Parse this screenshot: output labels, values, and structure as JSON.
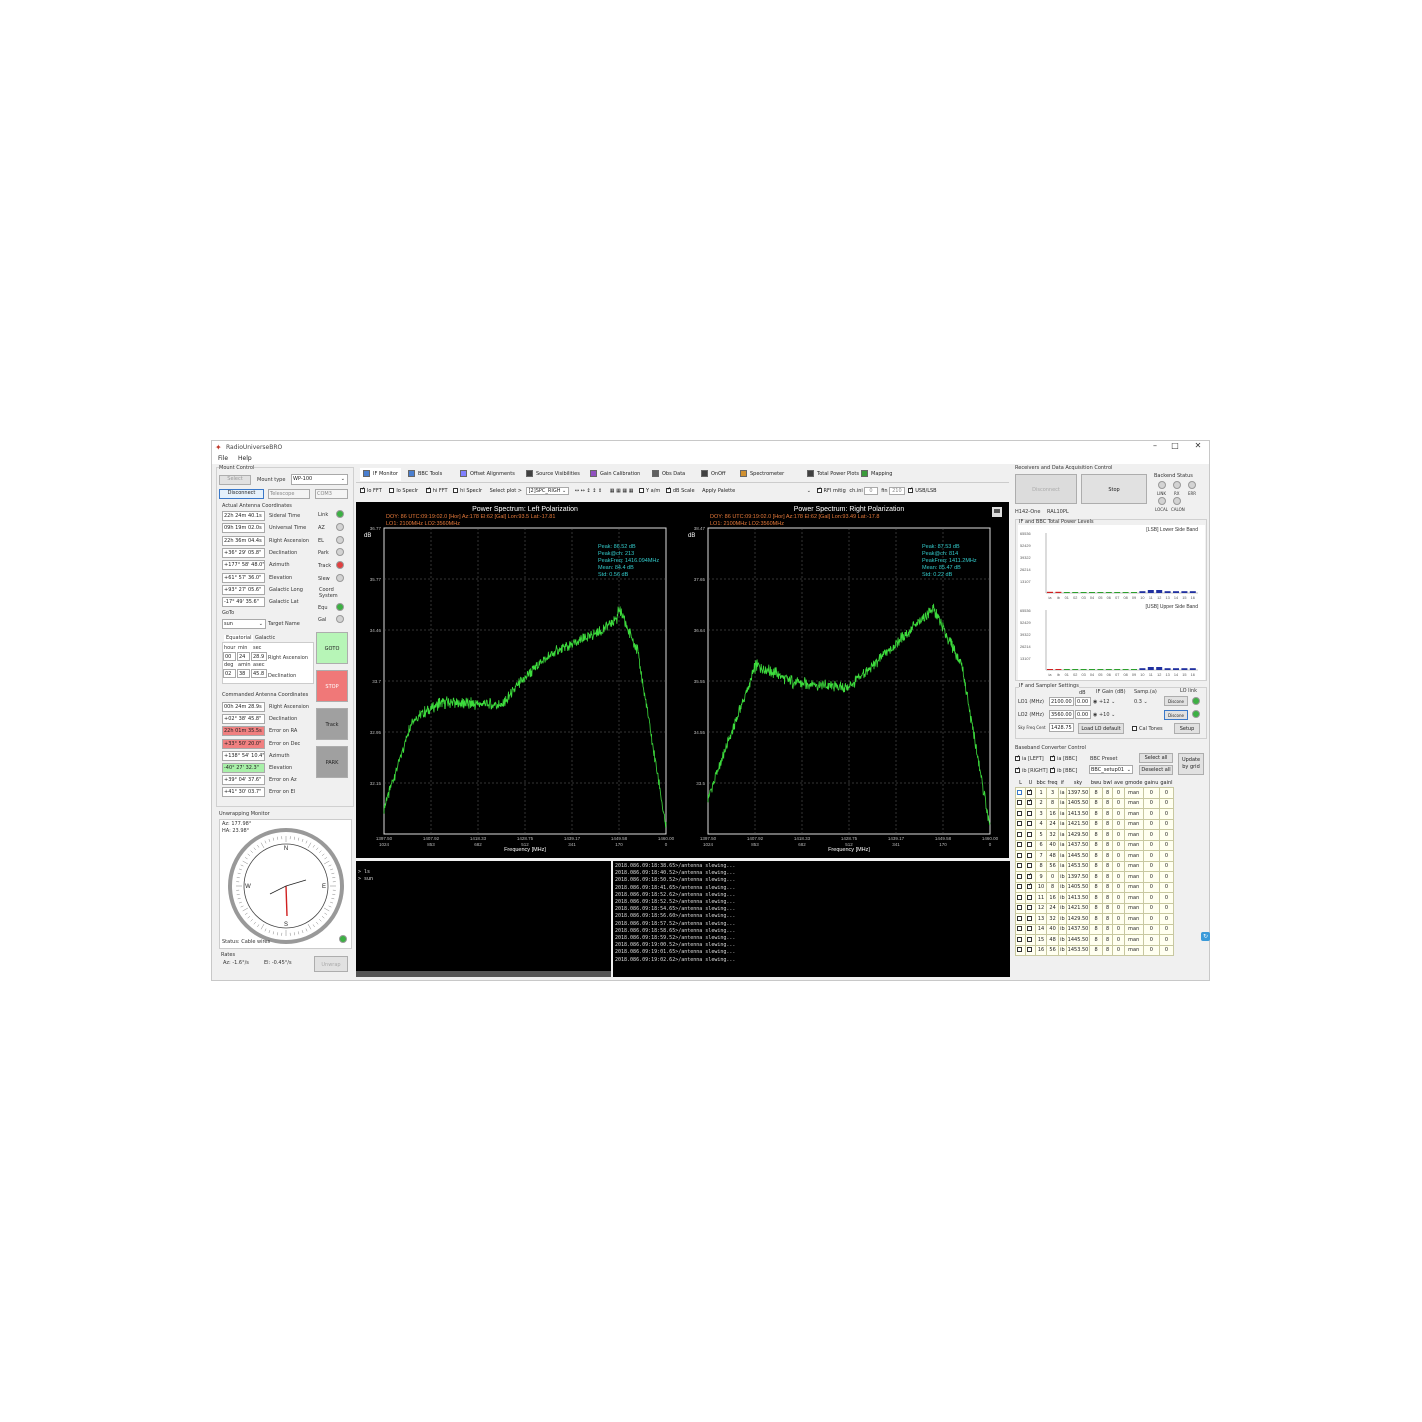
{
  "app": {
    "title": "RadioUniverseBRO"
  },
  "menu": [
    "File",
    "Help"
  ],
  "mount": {
    "title": "Mount Control",
    "select_label": "Select",
    "mount_type_label": "Mount type",
    "mount_type": "WP-100",
    "disconnect_label": "Disconnect",
    "telescope_label": "Telescope",
    "com_port": "COM3",
    "actual_title": "Actual Antenna Coordinates",
    "actual": [
      {
        "value": "22h 24m 40.1s",
        "label": "Sideral Time"
      },
      {
        "value": "09h 19m 02.0s",
        "label": "Universal Time"
      },
      {
        "value": "22h 36m 04.4s",
        "label": "Right Ascension"
      },
      {
        "value": "+36° 29' 05.8\"",
        "label": "Declination"
      },
      {
        "value": "+177° 58' 48.0\"",
        "label": "Azimuth"
      },
      {
        "value": "+61° 57' 36.0\"",
        "label": "Elevation"
      },
      {
        "value": "+93° 27' 05.6\"",
        "label": "Galactic Long"
      },
      {
        "value": "-17° 49' 35.6\"",
        "label": "Galactic Lat"
      }
    ],
    "status_leds": [
      "Link",
      "AZ",
      "EL",
      "Park",
      "Track",
      "Slew"
    ],
    "coord_system_label": "Coord System",
    "coord_leds": [
      "Equ",
      "Gal"
    ],
    "goto_title": "GoTo",
    "target": "sun",
    "target_label": "Target Name",
    "eq_tab": "Equatorial",
    "gal_tab": "Galactic",
    "ra_headers": [
      "hour",
      "min",
      "sec"
    ],
    "ra": [
      "00",
      "24",
      "28.9"
    ],
    "ra_label": "Right Ascension",
    "dec_headers": [
      "deg",
      "amin",
      "asec"
    ],
    "dec": [
      "02",
      "38",
      "45.8"
    ],
    "dec_label": "Declination",
    "goto_btn": "GOTO",
    "stop_btn": "STOP",
    "track_btn": "Track",
    "park_btn": "PARK",
    "cmd_title": "Commanded Antenna Coordinates",
    "cmd": [
      {
        "value": "00h 24m 28.9s",
        "label": "Right Ascension"
      },
      {
        "value": "+02° 38' 45.8\"",
        "label": "Declination"
      },
      {
        "value": "22h 01m 35.5s",
        "label": "Error on RA"
      },
      {
        "value": "+33° 50' 20.0\"",
        "label": "Error on Dec"
      },
      {
        "value": "+138° 54' 10.4\"",
        "label": "Azimuth"
      },
      {
        "value": "-40° 27' 32.3\"",
        "label": "Elevation"
      },
      {
        "value": "+39° 04' 37.6\"",
        "label": "Error on Az"
      },
      {
        "value": "+41° 30' 03.7\"",
        "label": "Error on El"
      }
    ],
    "unwrap_title": "Unwrapping Monitor",
    "unwrap_az": "Az: 177.98°",
    "unwrap_ha": "HA: 23.98°",
    "compass": [
      "N",
      "E",
      "S",
      "W"
    ],
    "cable_status": "Status: Cable wires",
    "rates_title": "Rates",
    "rate_az": "Az: -1.6°/s",
    "rate_el": "El: -0.45°/s",
    "unwrap_btn": "Unwrap"
  },
  "tabs": [
    "IF Monitor",
    "BBC Tools",
    "Offset Alignments",
    "Source Visibilities",
    "Gain Calibration",
    "Obs Data",
    "OnOff",
    "Spectrometer",
    "Total Power Plots",
    "Mapping"
  ],
  "toolbar": {
    "lfft": "lo FFT",
    "lspec": "lo SpecIr",
    "hfft": "hi FFT",
    "hspec": "hi SpecIr",
    "select_plot_label": "Select plot >",
    "select_plot": "[2]SPC_RIGH",
    "ylin": "Y a/m",
    "dbscale": "dB Scale",
    "palette": "Apply Palette",
    "rfi": "RFI mitig",
    "ch_label": "ch.ini",
    "ch_val": "0",
    "fin_label": "fin",
    "fin_val": "210",
    "usb": "USB/LSB"
  },
  "plots": [
    {
      "title": "Power Spectrum: Left Polarization",
      "info1": "DOY: 86   UTC:09:19:02.0   [Hor] Az:178   El:62   [Gal] Lon:93.5   Lat:-17.81",
      "info2": "LO1: 2100MHz   LO2:3560MHz",
      "ylabel": "dB",
      "yticks": [
        "36.77",
        "35.77",
        "34.46",
        "33.7",
        "32.95",
        "32.15"
      ],
      "xticks": [
        "1397.50",
        "1407.92",
        "1418.33",
        "1428.75",
        "1439.17",
        "1449.58",
        "1460.00"
      ],
      "xticks2": [
        "1024",
        "853",
        "682",
        "512",
        "341",
        "170",
        "0"
      ],
      "xlabel": "Frequency [MHz]",
      "stats": [
        "Peak: 86.52 dB",
        "Peak@ch: 213",
        "PeakFreq: 1416.094MHz",
        "Mean: 84.4 dB",
        "Std: 0.56 dB"
      ]
    },
    {
      "title": "Power Spectrum: Right Polarization",
      "info1": "DOY: 86   UTC:09:19:02.0   [Hor] Az:178   El:62   [Gal] Lon:93.49   Lat:-17.8",
      "info2": "LO1: 2100MHz   LO2:3560MHz",
      "ylabel": "dB",
      "yticks": [
        "38.47",
        "37.65",
        "36.64",
        "35.55",
        "34.55",
        "33.5"
      ],
      "xticks": [
        "1397.50",
        "1407.92",
        "1418.33",
        "1428.75",
        "1439.17",
        "1449.58",
        "1460.00"
      ],
      "xticks2": [
        "1024",
        "853",
        "682",
        "512",
        "341",
        "170",
        "0"
      ],
      "xlabel": "Frequency [MHz]",
      "stats": [
        "Peak: 87.53 dB",
        "Peak@ch: 814",
        "PeakFreq: 1411.2MHz",
        "Mean: 85.47 dB",
        "Std: 0.22 dB"
      ]
    }
  ],
  "console_left": [
    "> ls",
    "> sun"
  ],
  "console_right": [
    "2018.086.09:18:38.65>/antenna slewing...",
    "2018.086.09:18:40.52>/antenna slewing...",
    "2018.086.09:18:50.52>/antenna slewing...",
    "2018.086.09:18:41.65>/antenna slewing...",
    "2018.086.09:18:52.62>/antenna slewing...",
    "2018.086.09:18:52.52>/antenna slewing...",
    "2018.086.09:18:54.65>/antenna slewing...",
    "2018.086.09:18:56.60>/antenna slewing...",
    "2018.086.09:18:57.52>/antenna slewing...",
    "2018.086.09:18:58.65>/antenna slewing...",
    "2018.086.09:18:59.52>/antenna slewing...",
    "2018.086.09:19:00.52>/antenna slewing...",
    "2018.086.09:19:01.65>/antenna slewing...",
    "2018.086.09:19:02.62>/antenna slewing..."
  ],
  "receiver": {
    "title": "Receivers and Data Acquisition Control",
    "disconnect_btn": "Disconnect",
    "stop_btn": "Stop",
    "backend_title": "Backend Status",
    "backend_leds": [
      "LINK",
      "RX",
      "ERR"
    ],
    "backend_leds2": [
      "LOCAL",
      "CALON"
    ],
    "rx_name": "H142-One",
    "rx_model": "RAL10PL",
    "tp_title": "IF and BBC Total Power Levels",
    "lsb_title": "[LSB] Lower Side Band",
    "usb_title": "[USB] Upper Side Band",
    "tp_yticks": [
      "65536",
      "52429",
      "39322",
      "26214",
      "13107"
    ],
    "tp_xticks": [
      "ia",
      "ib",
      "01",
      "02",
      "03",
      "04",
      "05",
      "06",
      "07",
      "08",
      "09",
      "10",
      "11",
      "12",
      "13",
      "14",
      "15",
      "16"
    ],
    "lsb_levels": [
      0.02,
      0.02,
      0.01,
      0.01,
      0.01,
      0.01,
      0.01,
      0.01,
      0.01,
      0.01,
      0.01,
      0.03,
      0.05,
      0.05,
      0.03,
      0.03,
      0.03,
      0.03
    ],
    "usb_levels": [
      0.01,
      0.01,
      0.01,
      0.01,
      0.01,
      0.01,
      0.01,
      0.01,
      0.01,
      0.01,
      0.01,
      0.03,
      0.05,
      0.05,
      0.03,
      0.03,
      0.03,
      0.03
    ],
    "sampler_title": "IF and Sampler Settings",
    "if_gain_label": "IF Gain (dB)",
    "samp_label": "Samp.(a)",
    "lo_link": "LO link",
    "db_label": "dB",
    "lo1_label": "LO1 (MHz)",
    "lo1": "2100.00",
    "lo1_att": "0.00",
    "lo1_gain": "+12",
    "lo1_samp": "0.3",
    "lo1_btn": "Discone",
    "lo2_label": "LO2 (MHz)",
    "lo2": "3560.00",
    "lo2_att": "0.00",
    "lo2_gain": "+10",
    "lo2_btn": "Discone",
    "sky_label": "Sky Freq Cent",
    "sky": "1428.75",
    "load_lo": "Load LO default",
    "cal_tones": "Cal Tones",
    "setup": "Setup"
  },
  "bbc": {
    "title": "Baseband Converter Control",
    "ia_left": "ia [LEFT]",
    "ia_bbc": "ia [BBC]",
    "ib_right": "ib [RIGHT]",
    "ib_bbc": "ib [BBC]",
    "preset_label": "BBC Preset",
    "preset": "BBC_setup01",
    "select_all": "Select all",
    "deselect_all": "Deselect all",
    "update": "Update by grid",
    "headers": [
      "L",
      "U",
      "bbc",
      "freq",
      "if",
      "sky",
      "bwu",
      "bwl",
      "ave",
      "gmode",
      "gainu",
      "gainl"
    ],
    "rows": [
      [
        "1",
        "3",
        "ia",
        "1397.50",
        "8",
        "8",
        "0",
        "man",
        "0",
        "0"
      ],
      [
        "2",
        "8",
        "ia",
        "1405.50",
        "8",
        "8",
        "0",
        "man",
        "0",
        "0"
      ],
      [
        "3",
        "16",
        "ia",
        "1413.50",
        "8",
        "8",
        "0",
        "man",
        "0",
        "0"
      ],
      [
        "4",
        "24",
        "ia",
        "1421.50",
        "8",
        "8",
        "0",
        "man",
        "0",
        "0"
      ],
      [
        "5",
        "32",
        "ia",
        "1429.50",
        "8",
        "8",
        "0",
        "man",
        "0",
        "0"
      ],
      [
        "6",
        "40",
        "ia",
        "1437.50",
        "8",
        "8",
        "0",
        "man",
        "0",
        "0"
      ],
      [
        "7",
        "48",
        "ia",
        "1445.50",
        "8",
        "8",
        "0",
        "man",
        "0",
        "0"
      ],
      [
        "8",
        "56",
        "ia",
        "1453.50",
        "8",
        "8",
        "0",
        "man",
        "0",
        "0"
      ],
      [
        "9",
        "0",
        "ib",
        "1397.50",
        "8",
        "8",
        "0",
        "man",
        "0",
        "0"
      ],
      [
        "10",
        "8",
        "ib",
        "1405.50",
        "8",
        "8",
        "0",
        "man",
        "0",
        "0"
      ],
      [
        "11",
        "16",
        "ib",
        "1413.50",
        "8",
        "8",
        "0",
        "man",
        "0",
        "0"
      ],
      [
        "12",
        "24",
        "ib",
        "1421.50",
        "8",
        "8",
        "0",
        "man",
        "0",
        "0"
      ],
      [
        "13",
        "32",
        "ib",
        "1429.50",
        "8",
        "8",
        "0",
        "man",
        "0",
        "0"
      ],
      [
        "14",
        "40",
        "ib",
        "1437.50",
        "8",
        "8",
        "0",
        "man",
        "0",
        "0"
      ],
      [
        "15",
        "48",
        "ib",
        "1445.50",
        "8",
        "8",
        "0",
        "man",
        "0",
        "0"
      ],
      [
        "16",
        "56",
        "ib",
        "1453.50",
        "8",
        "8",
        "0",
        "man",
        "0",
        "0"
      ]
    ],
    "checked_u": [
      0,
      1,
      8,
      9
    ]
  },
  "colors": {
    "trace": "#3ddc3d",
    "stats": "#33cccc",
    "info": "#e87a3a",
    "led_green": "#3cb043",
    "led_red": "#e04040",
    "goto_bg": "#b7f5b7",
    "stop_bg": "#f07878",
    "err_bg": "#f08080",
    "ok_bg": "#a8f0a8"
  }
}
